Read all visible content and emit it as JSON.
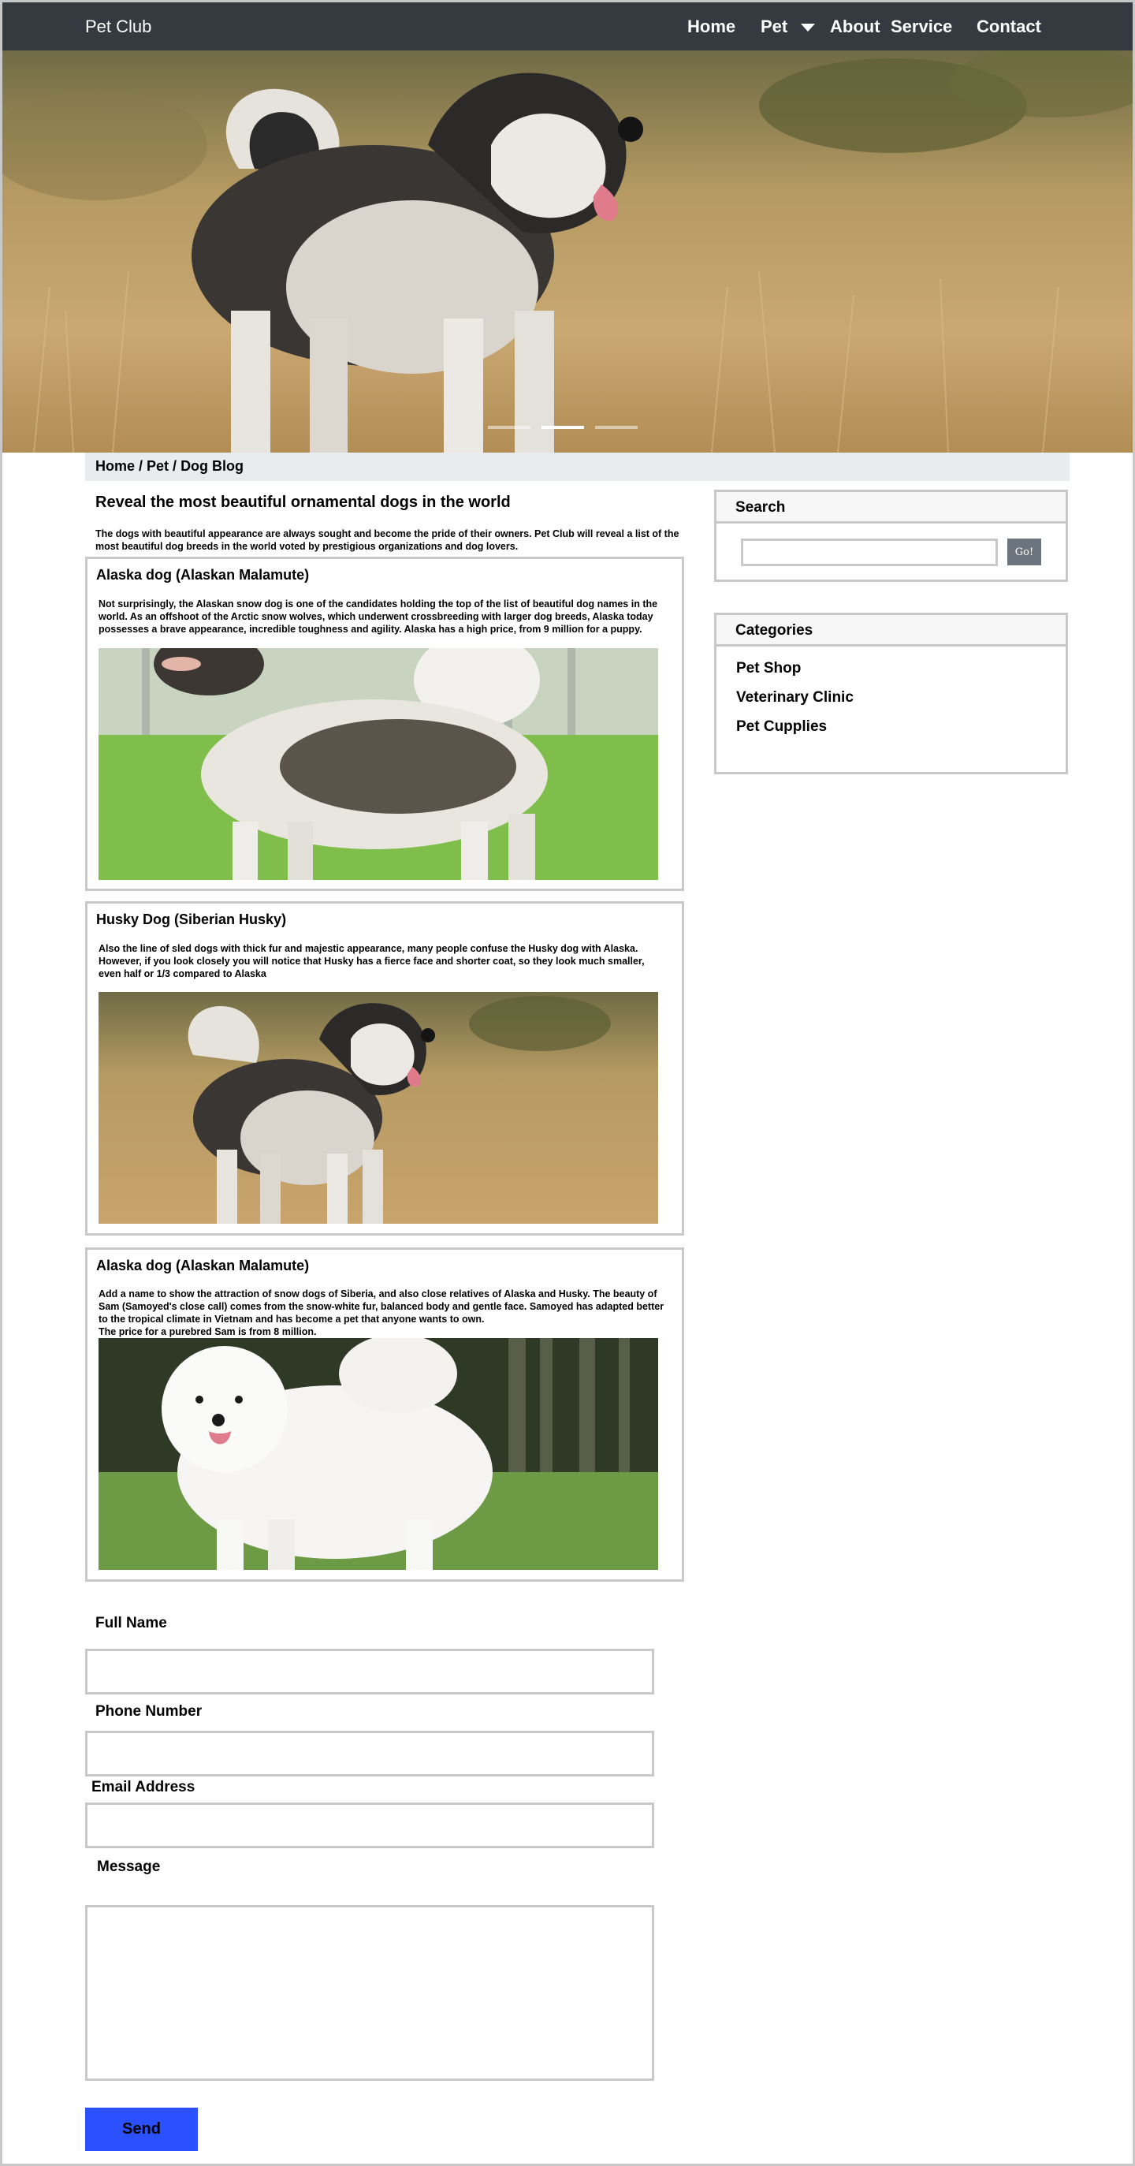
{
  "navbar": {
    "brand": "Pet Club",
    "items": [
      {
        "label": "Home"
      },
      {
        "label": "Pet"
      },
      {
        "label": "About"
      },
      {
        "label": "Service"
      },
      {
        "label": "Contact"
      }
    ]
  },
  "hero": {
    "image": "husky-in-field",
    "carousel_slide_count": 3,
    "active_slide": 2
  },
  "breadcrumb": {
    "items": [
      "Home",
      "Pet",
      "Dog Blog"
    ],
    "separator": " / "
  },
  "main": {
    "title": "Reveal the most beautiful ornamental dogs in the world",
    "description": "The dogs with beautiful appearance are always sought and become the pride of their owners. Pet Club will reveal a list of the most beautiful dog breeds in the world voted by prestigious organizations and dog lovers.",
    "cards": [
      {
        "title": "Alaska dog (Alaskan Malamute)",
        "text": "Not surprisingly, the Alaskan snow dog is one of the candidates holding the top of the list of beautiful dog names in the world. As an offshoot of the Arctic snow wolves, which underwent crossbreeding with larger dog breeds, Alaska today possesses a brave appearance, incredible toughness and agility. Alaska has a high price, from 9 million for a puppy.",
        "image": "alaskan-malamute-on-grass"
      },
      {
        "title": "Husky Dog (Siberian Husky)",
        "text": "Also the line of sled dogs with thick fur and majestic appearance, many people confuse the Husky dog with Alaska. However, if you look closely you will notice that Husky has a fierce face and shorter coat, so they look much smaller, even half or 1/3 compared to Alaska",
        "image": "husky-in-field"
      },
      {
        "title": "Alaska dog (Alaskan Malamute)",
        "text_lines": [
          "Add a name to show the attraction of snow dogs of Siberia, and also close relatives of Alaska and Husky. The beauty of Sam (Samoyed's close call) comes from the snow-white fur, balanced body and gentle face. Samoyed has adapted better to the tropical climate in Vietnam and has become a pet that anyone wants to own.",
          "The price for a purebred Sam is from 8 million."
        ],
        "image": "samoyed-on-grass"
      }
    ]
  },
  "sidebar": {
    "search": {
      "title": "Search",
      "value": "",
      "button_label": "Go!"
    },
    "categories": {
      "title": "Categories",
      "items": [
        "Pet Shop",
        "Veterinary Clinic",
        "Pet Cupplies"
      ]
    }
  },
  "form": {
    "full_name_label": "Full Name",
    "phone_label": "Phone Number",
    "email_label": "Email Address",
    "message_label": "Message",
    "full_name_value": "",
    "phone_value": "",
    "email_value": "",
    "message_value": "",
    "send_label": "Send"
  },
  "colors": {
    "navbar_bg": "#343a40",
    "breadcrumb_bg": "#e9ecef",
    "border": "#c8c8c8",
    "go_button": "#6c757d",
    "send_button": "#2b50ff"
  }
}
